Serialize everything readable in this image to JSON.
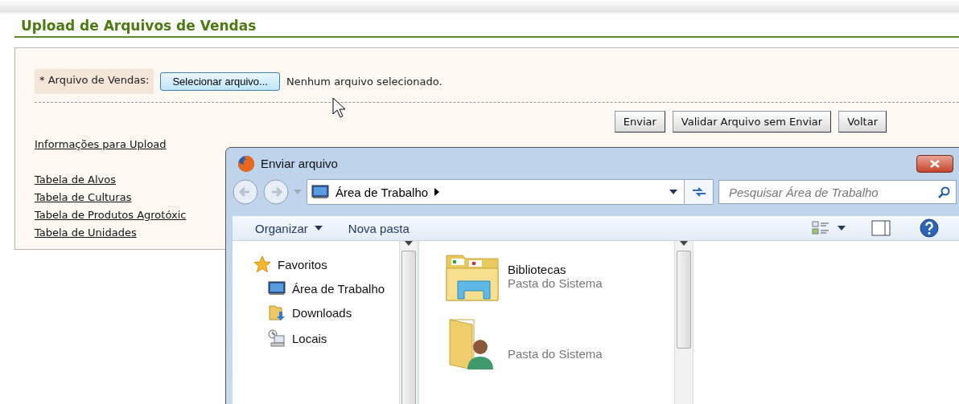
{
  "page": {
    "title": "Upload de Arquivos de Vendas"
  },
  "form": {
    "file_label": "* Arquivo de Vendas:",
    "choose_button": "Selecionar arquivo...",
    "file_status": "Nenhum arquivo selecionado.",
    "buttons": [
      "Enviar",
      "Validar Arquivo sem Enviar",
      "Voltar"
    ]
  },
  "info_link": "Informações para Upload",
  "table_links": [
    "Tabela de Alvos",
    "Tabela de Culturas",
    "Tabela de Produtos Agrotóxic",
    "Tabela de Unidades"
  ],
  "dialog": {
    "title": "Enviar arquivo",
    "address": "Área de Trabalho",
    "search": {
      "placeholder": "Pesquisar Área de Trabalho"
    },
    "toolbar": [
      {
        "label": "Organizar",
        "kind": "menu"
      },
      {
        "label": "Nova pasta",
        "kind": "command"
      }
    ],
    "nav": [
      {
        "label": "Favoritos",
        "kind": "star"
      },
      {
        "label": "Área de Trabalho",
        "kind": "desktop"
      },
      {
        "label": "Downloads",
        "kind": "downloads"
      },
      {
        "label": "Locais",
        "kind": "recent"
      }
    ],
    "items": [
      {
        "name": "Bibliotecas",
        "subtitle": "Pasta do Sistema",
        "kind": "library"
      },
      {
        "subtitle": "Pasta do Sistema",
        "kind": "user"
      }
    ]
  }
}
